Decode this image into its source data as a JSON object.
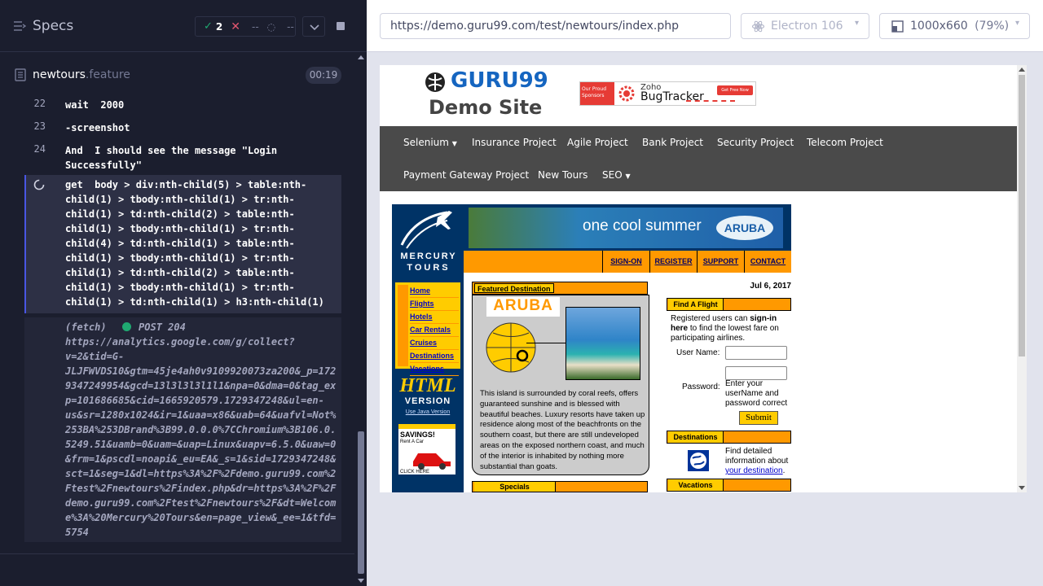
{
  "runner": {
    "specs_label": "Specs",
    "passed": "2",
    "failed": "--",
    "pending": "--",
    "file_name": "newtours",
    "file_ext": ".feature",
    "timer": "00:19",
    "lines": [
      {
        "num": "22",
        "text": "wait  2000"
      },
      {
        "num": "23",
        "text": "-screenshot"
      },
      {
        "num": "24",
        "text": "And  I should see the message \"Login\nSuccessfully\""
      }
    ],
    "get_cmd": "get  body > div:nth-child(5) > table:nth-\nchild(1) > tbody:nth-child(1) > tr:nth-\nchild(1) > td:nth-child(2) > table:nth-\nchild(1) > tbody:nth-child(1) > tr:nth-\nchild(4) > td:nth-child(1) > table:nth-\nchild(1) > tbody:nth-child(1) > tr:nth-\nchild(1) > td:nth-child(2) > table:nth-\nchild(1) > tbody:nth-child(1) > tr:nth-\nchild(1) > td:nth-child(1) > h3:nth-child(1)",
    "fetch_label": "(fetch)",
    "fetch_method": "POST 204",
    "fetch_url": "https://analytics.google.com/g/collect?\nv=2&tid=G-\nJLJFWVDS10&gtm=45je4ah0v9109920073za200&_p=172\n9347249954&gcd=13l3l3l3l1l1&npa=0&dma=0&tag_ex\np=101686685&cid=1665920579.1729347248&ul=en-\nus&sr=1280x1024&ir=1&uaa=x86&uab=64&uafvl=Not%\n253BA%253DBrand%3B99.0.0.0%7CChromium%3B106.0.\n5249.51&uamb=0&uam=&uap=Linux&uapv=6.5.0&uaw=0\n&frm=1&pscdl=noapi&_eu=EA&_s=1&sid=1729347248&\nsct=1&seg=1&dl=https%3A%2F%2Fdemo.guru99.com%2\nFtest%2Fnewtours%2Findex.php&dr=https%3A%2F%2F\ndemo.guru99.com%2Ftest%2Fnewtours%2F&dt=Welcom\ne%3A%20Mercury%20Tours&en=page_view&_ee=1&tfd=\n5754"
  },
  "browser": {
    "url": "https://demo.guru99.com/test/newtours/index.php",
    "browser_name": "Electron 106",
    "viewport": "1000x660",
    "zoom": "(79%)"
  },
  "site": {
    "logo_text": "GURU99",
    "subtitle": "Demo Site",
    "ad_sponsor": "Our Proud Sponsors",
    "ad_brand_small": "Zoho",
    "ad_brand": "BugTracker",
    "ad_cta": "Get Free Now",
    "nav": [
      "Selenium",
      "Insurance Project",
      "Agile Project",
      "Bank Project",
      "Security Project",
      "Telecom Project",
      "Payment Gateway Project",
      "New Tours",
      "SEO"
    ],
    "banner_text": "one cool summer",
    "banner_brand": "ARUBA",
    "mercury_top": "MERCURY",
    "mercury_bottom": "TOURS",
    "topnav": [
      "SIGN-ON",
      "REGISTER",
      "SUPPORT",
      "CONTACT"
    ],
    "side_links": [
      "Home",
      "Flights",
      "Hotels",
      "Car Rentals",
      "Cruises",
      "Destinations",
      "Vacations"
    ],
    "html_label": "HTML",
    "version_label": "VERSION",
    "java_link": "Use Java Version",
    "savings": "SAVINGS!",
    "rent_car": "Rent A Car",
    "click_here": "CLICK HERE",
    "featured_title": "Featured Destination",
    "featured_name": "ARUBA",
    "featured_desc": "This island is surrounded by coral reefs, offers guaranteed sunshine and is blessed with beautiful beaches. Luxury resorts have taken up residence along most of the beachfronts on the southern coast, but there are still undeveloped areas on the exposed northern coast, and much of the interior is inhabited by nothing more substantial than goats.",
    "specials_title": "Specials",
    "date": "Jul 6, 2017",
    "find_flight_title": "Find A Flight",
    "find_flight_pre": "Registered users can ",
    "find_flight_bold": "sign-in here",
    "find_flight_post": " to find the lowest fare on participating airlines.",
    "username_label": "User Name:",
    "password_label": "Password:",
    "password_hint": "Enter your userName and password correct",
    "submit_label": "Submit",
    "destinations_title": "Destinations",
    "dest_text": "Find detailed information about",
    "dest_link": "your destination",
    "dest_dot": ".",
    "vacations_title": "Vacations"
  }
}
